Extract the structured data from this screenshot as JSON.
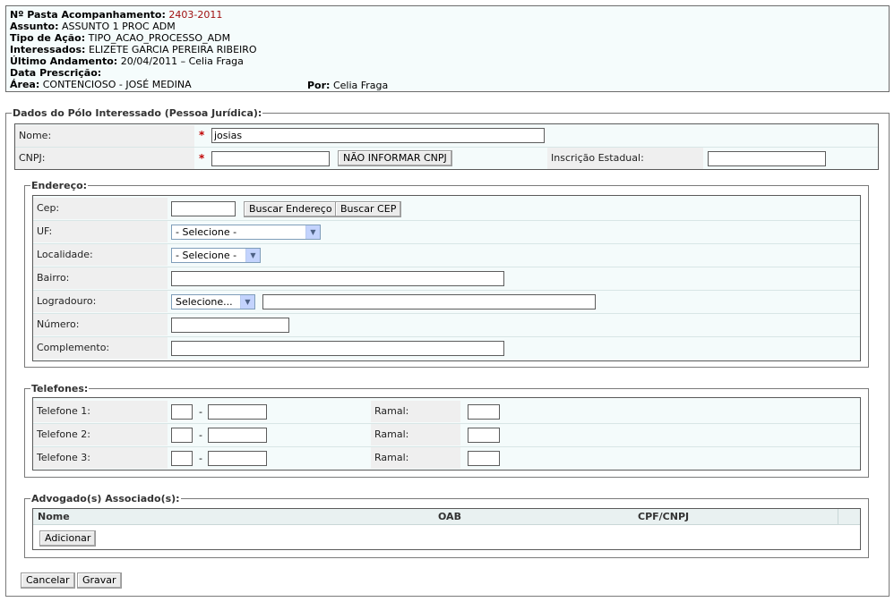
{
  "header": {
    "pasta_label": "Nº Pasta Acompanhamento:",
    "pasta_value": "2403-2011",
    "assunto_label": "Assunto:",
    "assunto_value": "ASSUNTO 1 PROC ADM",
    "tipo_label": "Tipo de Ação:",
    "tipo_value": "TIPO_ACAO_PROCESSO_ADM",
    "interessados_label": "Interessados:",
    "interessados_value": "ELIZETE GARCIA PEREIRA RIBEIRO",
    "ultimo_label": "Último Andamento:",
    "ultimo_value": "20/04/2011 – Celia Fraga",
    "prescricao_label": "Data Prescrição:",
    "area_label": "Área:",
    "area_value": "CONTENCIOSO - JOSÉ MEDINA",
    "por_label": "Por:",
    "por_value": "Celia Fraga"
  },
  "main": {
    "legend": "Dados do Pólo Interessado (Pessoa Jurídica):",
    "nome_label": "Nome:",
    "nome_value": "josias",
    "cnpj_label": "CNPJ:",
    "cnpj_value": "",
    "nao_informar_cnpj": "NÃO INFORMAR CNPJ",
    "inscricao_label": "Inscrição Estadual:",
    "inscricao_value": "",
    "required_mark": "*"
  },
  "endereco": {
    "legend": "Endereço:",
    "cep_label": "Cep:",
    "buscar_endereco": "Buscar Endereço",
    "buscar_cep": "Buscar CEP",
    "uf_label": "UF:",
    "uf_selected": "- Selecione -",
    "localidade_label": "Localidade:",
    "localidade_selected": "- Selecione -",
    "bairro_label": "Bairro:",
    "logradouro_label": "Logradouro:",
    "logradouro_selected": "Selecione...",
    "numero_label": "Número:",
    "complemento_label": "Complemento:"
  },
  "telefones": {
    "legend": "Telefones:",
    "rows": [
      {
        "label": "Telefone 1:",
        "ramal_label": "Ramal:"
      },
      {
        "label": "Telefone 2:",
        "ramal_label": "Ramal:"
      },
      {
        "label": "Telefone 3:",
        "ramal_label": "Ramal:"
      }
    ],
    "dash": "-"
  },
  "advogados": {
    "legend": "Advogado(s) Associado(s):",
    "columns": [
      "Nome",
      "OAB",
      "CPF/CNPJ"
    ],
    "adicionar": "Adicionar"
  },
  "actions": {
    "cancelar": "Cancelar",
    "gravar": "Gravar"
  },
  "colors": {
    "panel_bg": "#f4fbfb",
    "label_bg": "#efefef",
    "required": "#c00000",
    "pasta_value": "#a01010"
  },
  "icons": {
    "select_arrow": "chevron-down-icon"
  }
}
